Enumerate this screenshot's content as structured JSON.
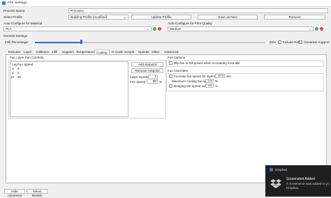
{
  "window": {
    "title": "FFF Settings"
  },
  "process": {
    "name_label": "Process Name:",
    "name_value": "Process1",
    "select_profile_label": "Select Profile",
    "profile_value": "Building Profile (modified)",
    "update_btn": "Update Profile",
    "save_new_btn": "Save as New",
    "remove_btn": "Remove"
  },
  "auto": {
    "material_label": "Auto-Configure for Material",
    "material_value": "PLA",
    "quality_label": "Auto-Configure for Print Quality",
    "quality_value": "Medium"
  },
  "general": {
    "label": "General Settings",
    "infill_label": "Infill Percentage:",
    "infill_value": "20%",
    "infill_fraction": 0.2,
    "raft_label": "Include Raft",
    "support_label": "Generate Support"
  },
  "tabs": [
    "Extruder",
    "Layer",
    "Additions",
    "Infill",
    "Support",
    "Temperature",
    "Cooling",
    "G-Code",
    "Scripts",
    "Speeds",
    "Other",
    "Advanced"
  ],
  "active_tab": "Cooling",
  "fan_controls": {
    "group_label": "Fan Layer Fan Controls",
    "col_layer": "Lay",
    "col_speed": "Fan Speed",
    "rows": [
      {
        "layer": "1",
        "speed": "0"
      },
      {
        "layer": "3",
        "speed": "0"
      },
      {
        "layer": "10",
        "speed": "50"
      }
    ],
    "add_btn": "Add Setpoint",
    "remove_btn": "Remove Setpoint",
    "layer_number_label": "Layer Number",
    "layer_number_value": "1",
    "fan_speed_label": "Fan Speed",
    "fan_speed_value": "80",
    "fan_speed_unit": "%"
  },
  "fan_options": {
    "label": "Fan Options",
    "blip_label": "Blip fan to full power when increasing from idle"
  },
  "fan_overrides": {
    "label": "Fan Overrides",
    "increase_label": "Increase fan speed for layers below",
    "increase_value": "60.0",
    "increase_unit": "sec",
    "max_label": "Maximum cooling fan speed",
    "max_value": "100",
    "max_unit": "%",
    "bridge_label": "Bridging fan speed override",
    "bridge_value": "100",
    "bridge_unit": "%"
  },
  "footer": {
    "hide_advanced": "Hide Advanced",
    "select_models": "Select Models"
  },
  "toast": {
    "app": "Dropbox",
    "title": "Screenshot Added",
    "body_line1": "A screenshot was added to yo",
    "body_line2": "Dropbox."
  }
}
